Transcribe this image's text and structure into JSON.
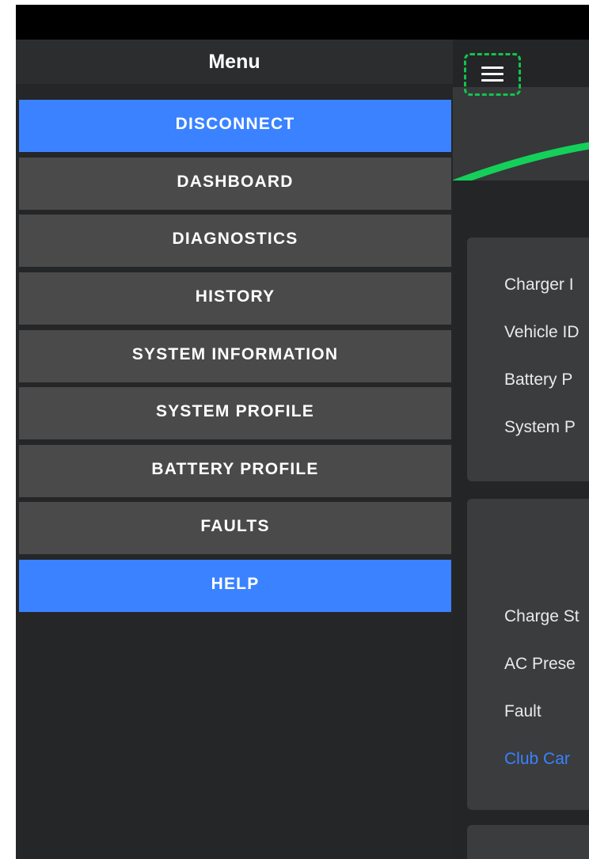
{
  "drawer": {
    "title": "Menu",
    "items": [
      {
        "label": "DISCONNECT",
        "accent": true
      },
      {
        "label": "DASHBOARD",
        "accent": false
      },
      {
        "label": "DIAGNOSTICS",
        "accent": false
      },
      {
        "label": "HISTORY",
        "accent": false
      },
      {
        "label": "SYSTEM INFORMATION",
        "accent": false
      },
      {
        "label": "SYSTEM PROFILE",
        "accent": false
      },
      {
        "label": "BATTERY PROFILE",
        "accent": false
      },
      {
        "label": "FAULTS",
        "accent": false
      },
      {
        "label": "HELP",
        "accent": true
      }
    ]
  },
  "main": {
    "menu_icon": "hamburger-menu-icon",
    "card1_rows": [
      "Charger I",
      "Vehicle ID",
      "Battery P",
      "System P"
    ],
    "card2_rows": [
      "Charge St",
      "AC Prese",
      "Fault",
      "Club Car"
    ]
  },
  "colors": {
    "accent": "#3a82ff",
    "gauge_green": "#14d05a",
    "focus_ring": "#14c24e",
    "menu_item_bg": "#4a4a4a",
    "background": "#222325"
  }
}
